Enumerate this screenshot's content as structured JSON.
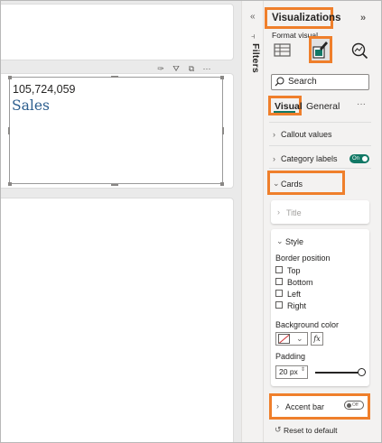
{
  "card": {
    "value": "105,724,059",
    "label": "Sales"
  },
  "filters": {
    "label": "Filters"
  },
  "visualizations": {
    "title": "Visualizations",
    "format_visual": "Format visual",
    "search_placeholder": "Search",
    "tabs": [
      {
        "label": "Visual"
      },
      {
        "label": "General"
      }
    ],
    "more": "···"
  },
  "sections": {
    "callout_values": "Callout values",
    "category_labels": "Category labels",
    "category_labels_toggle": "On",
    "cards": "Cards",
    "title": "Title",
    "style": "Style",
    "border_position": "Border position",
    "border_options": [
      "Top",
      "Bottom",
      "Left",
      "Right"
    ],
    "background_color": "Background color",
    "fx": "fx",
    "padding": "Padding",
    "padding_value": "20 px",
    "padding_level": 1.0,
    "accent_bar": "Accent bar",
    "accent_bar_toggle": "Off",
    "reset": "Reset to default"
  },
  "colors": {
    "highlight": "#ef7f2b",
    "accent": "#117865",
    "card_label": "#2b5d8d"
  }
}
